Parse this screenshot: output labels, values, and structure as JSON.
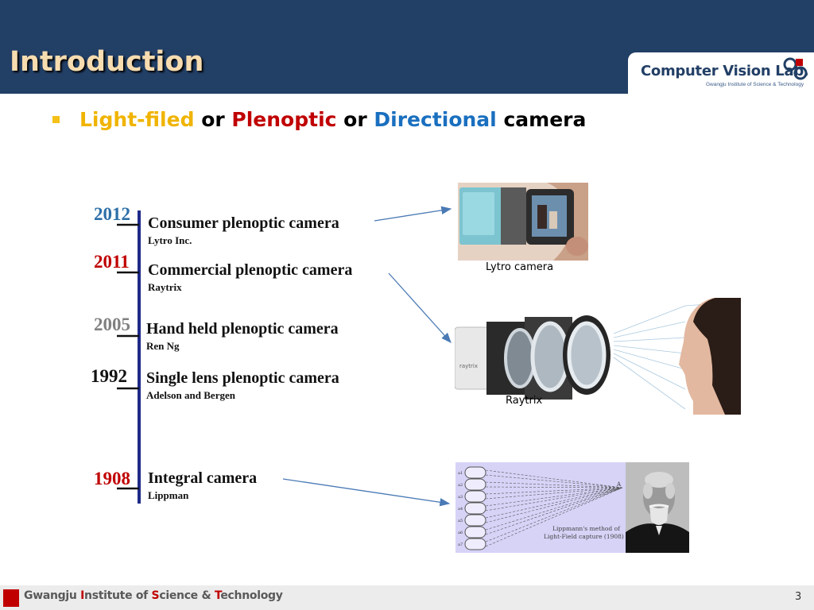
{
  "header": {
    "title": "Introduction",
    "logo_text": "Computer Vision Lab.",
    "logo_subtext": "Gwangju Institute of Science & Technology"
  },
  "bullet": {
    "part1": "Light-filed",
    "or1": " or ",
    "part2": "Plenoptic",
    "or2": " or ",
    "part3": "Directional",
    "part4": " camera"
  },
  "timeline": [
    {
      "year": "2012",
      "title": "Consumer plenoptic camera",
      "subtitle": "Lytro Inc.",
      "year_color": "#2c6fa8"
    },
    {
      "year": "2011",
      "title": "Commercial plenoptic camera",
      "subtitle": "Raytrix",
      "year_color": "#c00000"
    },
    {
      "year": "2005",
      "title": "Hand held plenoptic camera",
      "subtitle": "Ren Ng",
      "year_color": "#808080"
    },
    {
      "year": "1992",
      "title": "Single lens plenoptic camera",
      "subtitle": "Adelson and Bergen",
      "year_color": "#111111"
    },
    {
      "year": "1908",
      "title": "Integral camera",
      "subtitle": "Lippman",
      "year_color": "#c00000"
    }
  ],
  "images": {
    "lytro_caption": "Lytro camera",
    "raytrix_caption": "Raytrix",
    "raytrix_brand": "raytrix",
    "lippmann_caption_line1": "Lippmann's method of",
    "lippmann_caption_line2": "Light-Field capture (1908)",
    "lippmann_point": "A",
    "lippmann_row_labels": [
      "a1",
      "a2",
      "a3",
      "a4",
      "a5",
      "a6",
      "a7"
    ]
  },
  "footer": {
    "institute_prefix": "Gwangju ",
    "institute_i": "I",
    "institute_mid1": "nstitute of ",
    "institute_s": "S",
    "institute_mid2": "cience & ",
    "institute_t": "T",
    "institute_end": "echnology",
    "page_number": "3"
  }
}
